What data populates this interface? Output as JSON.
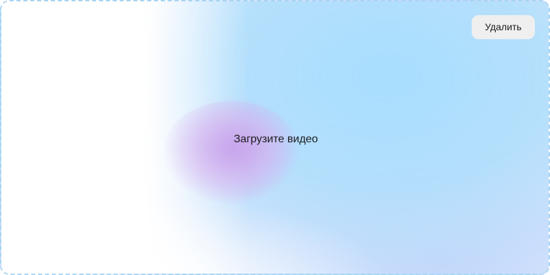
{
  "upload_zone": {
    "prompt": "Загрузите видео"
  },
  "actions": {
    "delete_label": "Удалить"
  },
  "colors": {
    "border": "#a9d4f2",
    "gradient_blue": "#a8defe",
    "gradient_purple": "#c4a0ec",
    "button_bg": "#efefef",
    "text": "#1b1b1f"
  }
}
